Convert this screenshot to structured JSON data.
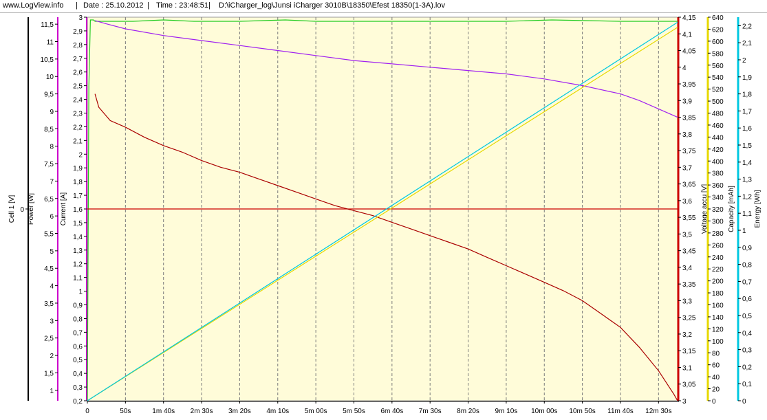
{
  "header": {
    "site": "www.LogView.info",
    "sep": "|",
    "date": "Date : 25.10.2012",
    "time": "Time : 23:48:51",
    "path": "D:\\iCharger_log\\Junsi iCharger 3010B\\18350\\Efest 18350(1-3A).lov"
  },
  "chart_data": {
    "type": "line",
    "background": "#fffcd9",
    "grid": "vertical dashed",
    "x_axis": {
      "unit": "seconds",
      "range": [
        0,
        775
      ],
      "tick_labels": [
        "0",
        "50s",
        "1m 40s",
        "2m 30s",
        "3m 20s",
        "4m 10s",
        "5m 00s",
        "5m 50s",
        "6m 40s",
        "7m 30s",
        "8m 20s",
        "9m 10s",
        "10m 00s",
        "10m 50s",
        "11m 40s",
        "12m 30s"
      ],
      "tick_values": [
        0,
        50,
        100,
        150,
        200,
        250,
        300,
        350,
        400,
        450,
        500,
        550,
        600,
        650,
        700,
        750
      ]
    },
    "axes": [
      {
        "id": "cell",
        "label": "Cell 1 [V]",
        "color": "#000000",
        "range": [
          -1,
          1
        ],
        "ticks": [
          0
        ]
      },
      {
        "id": "power",
        "label": "Power [W]",
        "color": "#cc00cc",
        "range": [
          0.7,
          11.7
        ],
        "ticks": [
          1,
          1.5,
          2,
          2.5,
          3,
          3.5,
          4,
          4.5,
          5,
          5.5,
          6,
          6.5,
          7,
          7.5,
          8,
          8.5,
          9,
          9.5,
          10,
          10.5,
          11,
          11.5
        ]
      },
      {
        "id": "current",
        "label": "Current [A]",
        "color": "#cc00cc",
        "range": [
          0.2,
          3
        ],
        "ticks": [
          0.2,
          0.3,
          0.4,
          0.5,
          0.6,
          0.7,
          0.8,
          0.9,
          1,
          1.1,
          1.2,
          1.3,
          1.4,
          1.5,
          1.6,
          1.7,
          1.8,
          1.9,
          2,
          2.1,
          2.2,
          2.3,
          2.4,
          2.5,
          2.6,
          2.7,
          2.8,
          2.9,
          3
        ]
      },
      {
        "id": "voltage",
        "label": "Voltage accu [V]",
        "color": "#cc0000",
        "range": [
          3,
          4.15
        ],
        "ticks": [
          3,
          3.05,
          3.1,
          3.15,
          3.2,
          3.25,
          3.3,
          3.35,
          3.4,
          3.45,
          3.5,
          3.55,
          3.6,
          3.65,
          3.7,
          3.75,
          3.8,
          3.85,
          3.9,
          3.95,
          4,
          4.05,
          4.1,
          4.15
        ]
      },
      {
        "id": "capacity",
        "label": "Capacity [mAh]",
        "color": "#e6d800",
        "range": [
          0,
          640
        ],
        "ticks": [
          0,
          20,
          40,
          60,
          80,
          100,
          120,
          140,
          160,
          180,
          200,
          220,
          240,
          260,
          280,
          300,
          320,
          340,
          360,
          380,
          400,
          420,
          440,
          460,
          480,
          500,
          520,
          540,
          560,
          580,
          600,
          620,
          640
        ]
      },
      {
        "id": "energy",
        "label": "Energy [Wh]",
        "color": "#00c8e0",
        "range": [
          0,
          2.25
        ],
        "ticks": [
          0,
          0.1,
          0.2,
          0.3,
          0.4,
          0.5,
          0.6,
          0.7,
          0.8,
          0.9,
          1,
          1.1,
          1.2,
          1.3,
          1.4,
          1.5,
          1.6,
          1.7,
          1.8,
          1.9,
          2,
          2.1,
          2.2
        ]
      }
    ],
    "series": [
      {
        "id": "current",
        "axis": "current",
        "color": "#22cc22",
        "points": [
          [
            0,
            0.2
          ],
          [
            2,
            2.5
          ],
          [
            4,
            2.98
          ],
          [
            8,
            2.98
          ],
          [
            10,
            2.97
          ],
          [
            60,
            2.97
          ],
          [
            100,
            2.98
          ],
          [
            140,
            2.97
          ],
          [
            200,
            2.97
          ],
          [
            260,
            2.98
          ],
          [
            300,
            2.97
          ],
          [
            400,
            2.97
          ],
          [
            550,
            2.97
          ],
          [
            610,
            2.98
          ],
          [
            700,
            2.97
          ],
          [
            775,
            2.97
          ]
        ]
      },
      {
        "id": "cell",
        "axis": "cell",
        "color": "#cc0000",
        "points": [
          [
            0,
            0
          ],
          [
            775,
            0
          ]
        ]
      },
      {
        "id": "voltage",
        "axis": "voltage",
        "color": "#aa0000",
        "points": [
          [
            10,
            3.92
          ],
          [
            15,
            3.88
          ],
          [
            30,
            3.84
          ],
          [
            50,
            3.82
          ],
          [
            75,
            3.79
          ],
          [
            100,
            3.765
          ],
          [
            125,
            3.745
          ],
          [
            150,
            3.72
          ],
          [
            175,
            3.7
          ],
          [
            200,
            3.685
          ],
          [
            225,
            3.665
          ],
          [
            250,
            3.645
          ],
          [
            275,
            3.625
          ],
          [
            300,
            3.605
          ],
          [
            325,
            3.585
          ],
          [
            350,
            3.57
          ],
          [
            375,
            3.555
          ],
          [
            400,
            3.535
          ],
          [
            425,
            3.515
          ],
          [
            450,
            3.495
          ],
          [
            475,
            3.475
          ],
          [
            500,
            3.455
          ],
          [
            525,
            3.43
          ],
          [
            550,
            3.405
          ],
          [
            575,
            3.38
          ],
          [
            600,
            3.355
          ],
          [
            625,
            3.33
          ],
          [
            650,
            3.3
          ],
          [
            675,
            3.26
          ],
          [
            700,
            3.22
          ],
          [
            725,
            3.16
          ],
          [
            750,
            3.09
          ],
          [
            770,
            3.02
          ],
          [
            775,
            3.0
          ]
        ]
      },
      {
        "id": "voltage_high",
        "axis": "voltage",
        "color": "#a020f0",
        "points": [
          [
            10,
            4.14
          ],
          [
            25,
            4.13
          ],
          [
            50,
            4.115
          ],
          [
            100,
            4.095
          ],
          [
            150,
            4.08
          ],
          [
            200,
            4.065
          ],
          [
            250,
            4.05
          ],
          [
            300,
            4.035
          ],
          [
            350,
            4.02
          ],
          [
            400,
            4.01
          ],
          [
            450,
            4.0
          ],
          [
            500,
            3.99
          ],
          [
            550,
            3.98
          ],
          [
            600,
            3.965
          ],
          [
            650,
            3.945
          ],
          [
            700,
            3.92
          ],
          [
            725,
            3.9
          ],
          [
            750,
            3.875
          ],
          [
            775,
            3.85
          ]
        ]
      },
      {
        "id": "capacity",
        "axis": "capacity",
        "color": "#e6d800",
        "points": [
          [
            0,
            0
          ],
          [
            775,
            623
          ]
        ]
      },
      {
        "id": "energy",
        "axis": "energy",
        "color": "#00c8e0",
        "points": [
          [
            0,
            0
          ],
          [
            775,
            2.22
          ]
        ]
      }
    ]
  }
}
